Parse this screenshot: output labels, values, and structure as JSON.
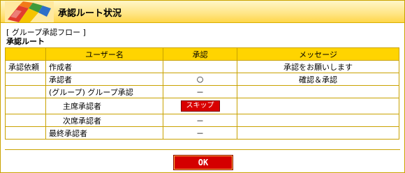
{
  "window": {
    "title": "承認ルート状況"
  },
  "flow": {
    "group_flow_label": "[ グループ承認フロー ]",
    "route_label": "承認ルート"
  },
  "table": {
    "headers": [
      "",
      "ユーザー名",
      "承認",
      "メッセージ"
    ],
    "rows": [
      {
        "category": "承認依頼",
        "user": "作成者",
        "approval": "",
        "message": "承認をお願いします"
      },
      {
        "category": "",
        "user": "承認者",
        "approval": "○",
        "message": "確認＆承認"
      },
      {
        "category": "",
        "user": "(グループ) グループ承認",
        "approval": "－",
        "message": ""
      },
      {
        "category": "",
        "user": "主席承認者",
        "approval": "",
        "message": ""
      },
      {
        "category": "",
        "user": "次席承認者",
        "approval": "－",
        "message": ""
      },
      {
        "category": "",
        "user": "最終承認者",
        "approval": "－",
        "message": ""
      }
    ]
  },
  "buttons": {
    "skip_label": "スキップ",
    "ok_label": "OK"
  },
  "colors": {
    "header_bg": "#ffd64a",
    "table_header_bg": "#ffd400",
    "border": "#c9a200",
    "button_red": "#d40000"
  },
  "icons": {
    "logo": "colorful-books-icon"
  }
}
